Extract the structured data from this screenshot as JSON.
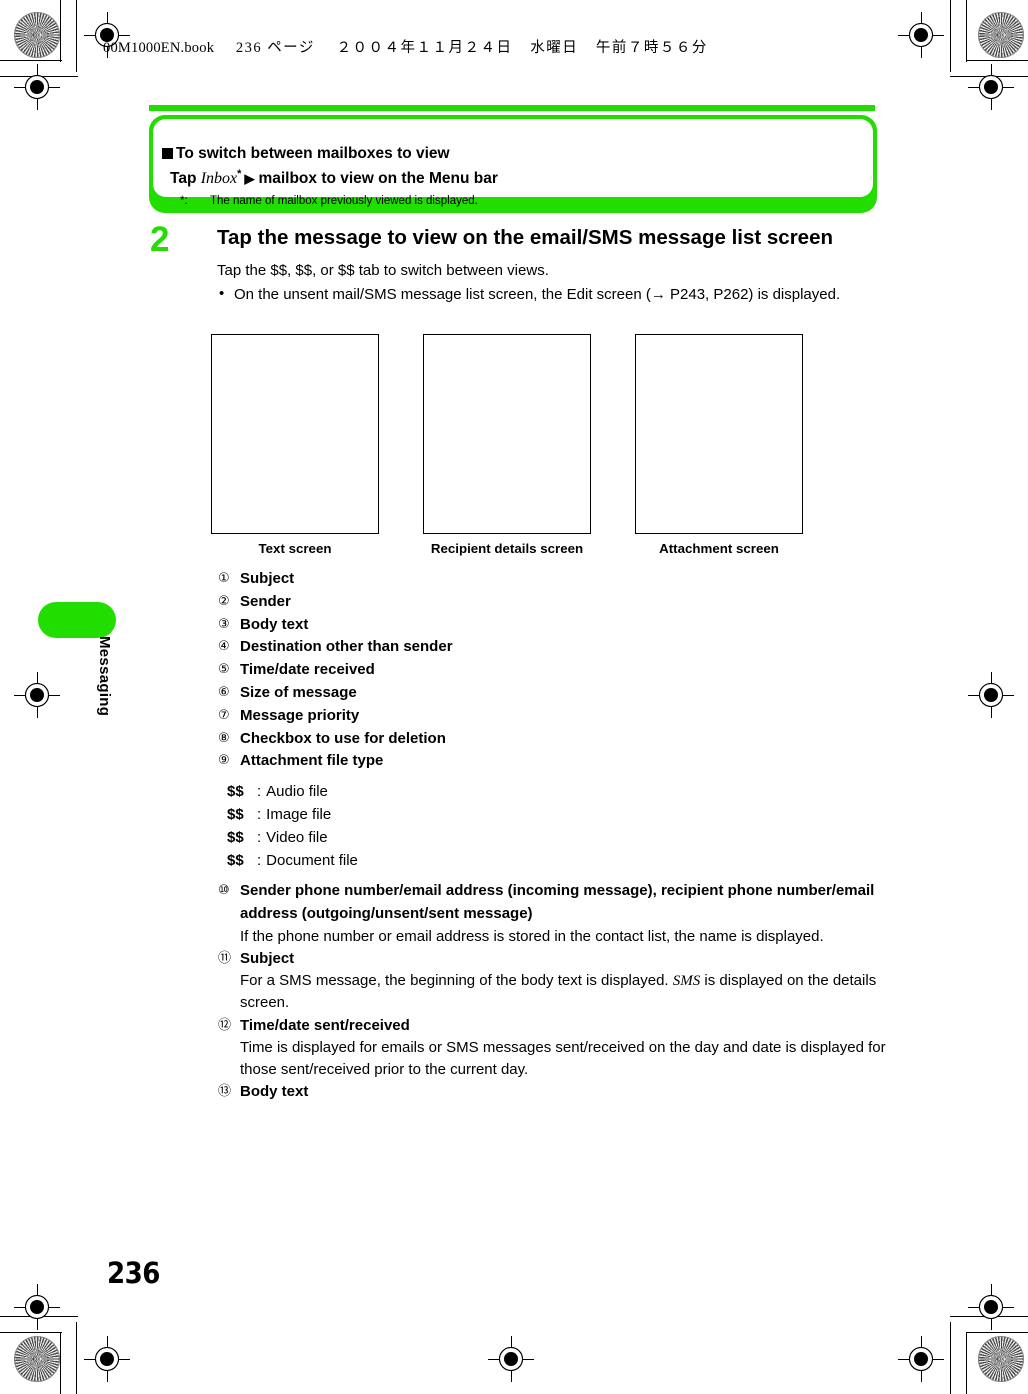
{
  "file_header": {
    "filename": "00M1000EN.book",
    "page_label": "236 ページ",
    "date": "２００４年１１月２４日",
    "weekday": "水曜日",
    "time": "午前７時５６分"
  },
  "side_tab": {
    "chapter_label": "Messaging"
  },
  "banner": {
    "heading": "To switch between mailboxes to view",
    "instruction_prefix": "Tap ",
    "instruction_italic": "Inbox",
    "instruction_star": "*",
    "instruction_arrow": "▶",
    "instruction_suffix": "mailbox to view on the Menu bar",
    "footnote_marker": "*:",
    "footnote_text": "The name of mailbox previously viewed is displayed."
  },
  "step": {
    "number": "2",
    "title": "Tap the message to view on the email/SMS message list screen",
    "body_line": "Tap the $$, $$, or $$ tab to switch between views.",
    "bullet": "On the unsent mail/SMS message list screen, the Edit screen (→ P243, P262) is displayed."
  },
  "screens": [
    {
      "caption": "Text screen"
    },
    {
      "caption": "Recipient details screen"
    },
    {
      "caption": "Attachment screen"
    }
  ],
  "callouts": [
    {
      "num": "①",
      "label": "Subject"
    },
    {
      "num": "②",
      "label": "Sender"
    },
    {
      "num": "③",
      "label": "Body text"
    },
    {
      "num": "④",
      "label": "Destination other than sender"
    },
    {
      "num": "⑤",
      "label": "Time/date received"
    },
    {
      "num": "⑥",
      "label": "Size of message"
    },
    {
      "num": "⑦",
      "label": "Message priority"
    },
    {
      "num": "⑧",
      "label": "Checkbox to use for deletion"
    },
    {
      "num": "⑨",
      "label": "Attachment file type"
    }
  ],
  "file_types": [
    {
      "key": "$$",
      "colon": ":",
      "label": "Audio file"
    },
    {
      "key": "$$",
      "colon": ":",
      "label": "Image file"
    },
    {
      "key": "$$",
      "colon": ":",
      "label": "Video file"
    },
    {
      "key": "$$",
      "colon": ":",
      "label": "Document file"
    }
  ],
  "callouts2": {
    "item10_num": "⑩",
    "item10_label": "Sender phone number/email address (incoming message), recipient phone number/email address (outgoing/unsent/sent message)",
    "item10_desc": "If the phone number or email address is stored in the contact list, the name is displayed.",
    "item11_num": "⑪",
    "item11_label": "Subject",
    "item11_desc_a": "For a SMS message, the beginning of the body text is displayed. ",
    "item11_desc_italic": "SMS",
    "item11_desc_b": " is displayed on the details screen.",
    "item12_num": "⑫",
    "item12_label": "Time/date sent/received",
    "item12_desc": "Time is displayed for emails or SMS messages sent/received on the day and date is displayed for those sent/received prior to the current day.",
    "item13_num": "⑬",
    "item13_label": "Body text"
  },
  "page_number": "236",
  "colors": {
    "accent_green": "#22dd00",
    "text_black": "#000000",
    "page_background": "#ffffff"
  }
}
